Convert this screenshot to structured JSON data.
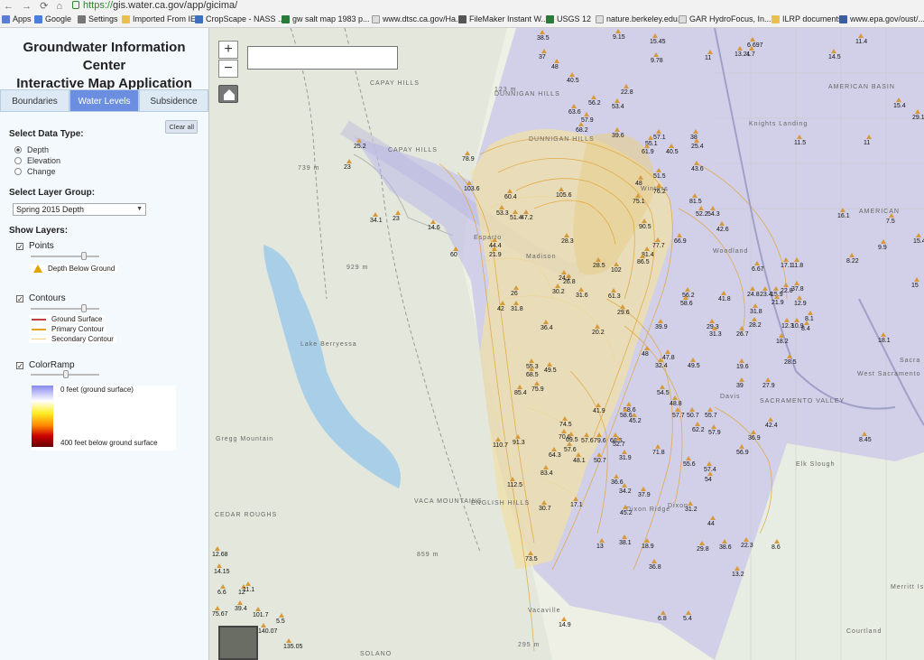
{
  "browser": {
    "url_scheme": "https://",
    "url_rest": "gis.water.ca.gov/app/gicima/",
    "bookmarks": [
      "Apps",
      "Google",
      "Settings",
      "Imported From IE",
      "CropScape - NASS ...",
      "gw salt map 1983 p...",
      "www.dtsc.ca.gov/Ha...",
      "FileMaker Instant W...",
      "USGS 12",
      "nature.berkeley.edu...",
      "GAR HydroFocus, In...",
      "ILRP documents",
      "www.epa.gov/oust/..."
    ]
  },
  "sidebar": {
    "title_line1": "Groundwater Information Center",
    "title_line2": "Interactive Map Application",
    "tabs": [
      "Boundaries",
      "Water Levels",
      "Subsidence"
    ],
    "active_tab": "Water Levels",
    "clear_all": "Clear all",
    "data_type_label": "Select Data Type:",
    "data_types": [
      "Depth",
      "Elevation",
      "Change"
    ],
    "selected_data_type": "Depth",
    "layer_group_label": "Select Layer Group:",
    "layer_group_value": "Spring 2015 Depth",
    "show_layers_label": "Show Layers:",
    "points_label": "Points",
    "points_legend": "Depth Below Ground",
    "contours_label": "Contours",
    "contour_legend": [
      "Ground Surface",
      "Primary Contour",
      "Secondary Contour"
    ],
    "colorramp_label": "ColorRamp",
    "ramp_top": "0 feet (ground surface)",
    "ramp_bottom": "400 feet below ground surface"
  },
  "map": {
    "points": [
      {
        "v": "38.5"
      },
      {
        "v": "9.15"
      },
      {
        "v": "15.45"
      },
      {
        "v": "6.697"
      },
      {
        "v": "11.4"
      },
      {
        "v": "37"
      },
      {
        "v": "48"
      },
      {
        "v": "9.78"
      },
      {
        "v": "11"
      },
      {
        "v": "13.21"
      },
      {
        "v": "4.7"
      },
      {
        "v": "14.5"
      },
      {
        "v": "40.5"
      },
      {
        "v": "22.8"
      },
      {
        "v": "56.2"
      },
      {
        "v": "53.4"
      },
      {
        "v": "63.6"
      },
      {
        "v": "57.9"
      },
      {
        "v": "68.2"
      },
      {
        "v": "39.6"
      },
      {
        "v": "57.1"
      },
      {
        "v": "55.1"
      },
      {
        "v": "38"
      },
      {
        "v": "25.2"
      },
      {
        "v": "23"
      },
      {
        "v": "78.9"
      },
      {
        "v": "61.9"
      },
      {
        "v": "40.5"
      },
      {
        "v": "25.4"
      },
      {
        "v": "43.6"
      },
      {
        "v": "103.6"
      },
      {
        "v": "105.6"
      },
      {
        "v": "60.4"
      },
      {
        "v": "51.5"
      },
      {
        "v": "48"
      },
      {
        "v": "76.2"
      },
      {
        "v": "75.1"
      },
      {
        "v": "81.5"
      },
      {
        "v": "52.2"
      },
      {
        "v": "54.3"
      },
      {
        "v": "53.3"
      },
      {
        "v": "51.4"
      },
      {
        "v": "47.2"
      },
      {
        "v": "34.1"
      },
      {
        "v": "23"
      },
      {
        "v": "14.6"
      },
      {
        "v": "90.5"
      },
      {
        "v": "42.6"
      },
      {
        "v": "28.3"
      },
      {
        "v": "77.7"
      },
      {
        "v": "66.9"
      },
      {
        "v": "44.4"
      },
      {
        "v": "21.9"
      },
      {
        "v": "60"
      },
      {
        "v": "81.4"
      },
      {
        "v": "86.5"
      },
      {
        "v": "28.5"
      },
      {
        "v": "102"
      },
      {
        "v": "24.2"
      },
      {
        "v": "26.8"
      },
      {
        "v": "30.2"
      },
      {
        "v": "31.6"
      },
      {
        "v": "26"
      },
      {
        "v": "61.3"
      },
      {
        "v": "56.2"
      },
      {
        "v": "58.6"
      },
      {
        "v": "41.8"
      },
      {
        "v": "42"
      },
      {
        "v": "31.8"
      },
      {
        "v": "29.6"
      },
      {
        "v": "36.4"
      },
      {
        "v": "20.2"
      },
      {
        "v": "39.9"
      },
      {
        "v": "29.3"
      },
      {
        "v": "31.3"
      },
      {
        "v": "26.7"
      },
      {
        "v": "48"
      },
      {
        "v": "47.8"
      },
      {
        "v": "32.4"
      },
      {
        "v": "49.5"
      },
      {
        "v": "19.6"
      },
      {
        "v": "55.3"
      },
      {
        "v": "68.5"
      },
      {
        "v": "49.5"
      },
      {
        "v": "85.4"
      },
      {
        "v": "75.9"
      },
      {
        "v": "39"
      },
      {
        "v": "27.9"
      },
      {
        "v": "54.5"
      },
      {
        "v": "48.8"
      },
      {
        "v": "58.6"
      },
      {
        "v": "41.9"
      },
      {
        "v": "58.6"
      },
      {
        "v": "45.2"
      },
      {
        "v": "57.7"
      },
      {
        "v": "50.7"
      },
      {
        "v": "55.7"
      },
      {
        "v": "42.4"
      },
      {
        "v": "62.2"
      },
      {
        "v": "57.9"
      },
      {
        "v": "36.9"
      },
      {
        "v": "74.5"
      },
      {
        "v": "70.6"
      },
      {
        "v": "69.5"
      },
      {
        "v": "57.6"
      },
      {
        "v": "79.6"
      },
      {
        "v": "68.5"
      },
      {
        "v": "91.3"
      },
      {
        "v": "110.7"
      },
      {
        "v": "57.6"
      },
      {
        "v": "64.3"
      },
      {
        "v": "52.7"
      },
      {
        "v": "48.1"
      },
      {
        "v": "50.7"
      },
      {
        "v": "31.9"
      },
      {
        "v": "71.8"
      },
      {
        "v": "55.6"
      },
      {
        "v": "57.4"
      },
      {
        "v": "56.9"
      },
      {
        "v": "83.4"
      },
      {
        "v": "112.5"
      },
      {
        "v": "36.6"
      },
      {
        "v": "34.2"
      },
      {
        "v": "37.9"
      },
      {
        "v": "54"
      },
      {
        "v": "30.7"
      },
      {
        "v": "17.1"
      },
      {
        "v": "45.2"
      },
      {
        "v": "31.2"
      },
      {
        "v": "13"
      },
      {
        "v": "38.1"
      },
      {
        "v": "18.9"
      },
      {
        "v": "29.8"
      },
      {
        "v": "38.6"
      },
      {
        "v": "22.3"
      },
      {
        "v": "8.6"
      },
      {
        "v": "44"
      },
      {
        "v": "73.5"
      },
      {
        "v": "36.8"
      },
      {
        "v": "13.2"
      },
      {
        "v": "14.9"
      },
      {
        "v": "6.8"
      },
      {
        "v": "5.4"
      },
      {
        "v": "6.67"
      },
      {
        "v": "17.1"
      },
      {
        "v": "11.8"
      },
      {
        "v": "8.22"
      },
      {
        "v": "24.8"
      },
      {
        "v": "23.4"
      },
      {
        "v": "15.9"
      },
      {
        "v": "22.8"
      },
      {
        "v": "21.9"
      },
      {
        "v": "37.8"
      },
      {
        "v": "12.9"
      },
      {
        "v": "31.8"
      },
      {
        "v": "28.2"
      },
      {
        "v": "12.3"
      },
      {
        "v": "10.9"
      },
      {
        "v": "8.4"
      },
      {
        "v": "8.1"
      },
      {
        "v": "18.2"
      },
      {
        "v": "28.5"
      },
      {
        "v": "11.5"
      },
      {
        "v": "11"
      },
      {
        "v": "16.1"
      },
      {
        "v": "7.5"
      },
      {
        "v": "15.4"
      },
      {
        "v": "29.1"
      },
      {
        "v": "15.4"
      },
      {
        "v": "15"
      },
      {
        "v": "18.1"
      },
      {
        "v": "9.9"
      },
      {
        "v": "8.45"
      },
      {
        "v": "12.68"
      },
      {
        "v": "14.15"
      },
      {
        "v": "6.6"
      },
      {
        "v": "12"
      },
      {
        "v": "11.1"
      },
      {
        "v": "39.4"
      },
      {
        "v": "75.67"
      },
      {
        "v": "101.7"
      },
      {
        "v": "5.5"
      },
      {
        "v": "140.07"
      },
      {
        "v": "135.05"
      }
    ],
    "places": [
      "CAPAY HILLS",
      "DUNNIGAN HILLS",
      "CAPAY HILLS",
      "DUNNIGAN HILLS",
      "Esparto",
      "Madison",
      "Woodland",
      "Davis",
      "West Sacramento",
      "Sacra",
      "SACRAMENTO VALLEY",
      "AMERICAN BASIN",
      "AMERICAN",
      "Knights Landing",
      "Lake Berryessa",
      "VACA MOUNTAINS",
      "ENGLISH HILLS",
      "Vacaville",
      "Dixon",
      "Gregg Mountain",
      "CEDAR ROUGHS",
      "Merritt Island",
      "Courtland",
      "Elk Slough",
      "Winters",
      "Dixon Ridge",
      "SOLANO",
      "123 m",
      "739 m",
      "929 m",
      "859 m",
      "295 m"
    ]
  }
}
